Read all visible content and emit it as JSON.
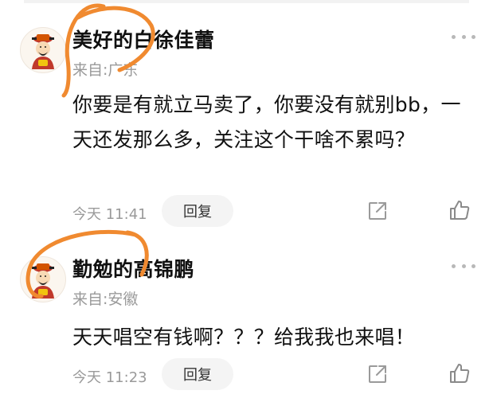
{
  "comments": [
    {
      "username": "美好的白徐佳蕾",
      "location": "来自:广东",
      "content": "你要是有就立马卖了，你要没有就别bb，一天还发那么多，关注这个干啥不累吗？",
      "timestamp": "今天 11:41",
      "reply_label": "回复",
      "icons": {
        "avatar": "god-of-wealth-avatar",
        "more": "more-dots-icon",
        "share": "share-icon",
        "like": "thumbs-up-icon"
      }
    },
    {
      "username": "勤勉的高锦鹏",
      "location": "来自:安徽",
      "content": "天天唱空有钱啊？？？给我我也来唱！",
      "timestamp": "今天 11:23",
      "reply_label": "回复",
      "icons": {
        "avatar": "god-of-wealth-avatar",
        "more": "more-dots-icon",
        "share": "share-icon",
        "like": "thumbs-up-icon"
      }
    }
  ],
  "colors": {
    "text": "#111111",
    "muted": "#9a9a9a",
    "reply_bg": "#f4f4f4",
    "annotation": "#f08a30"
  }
}
